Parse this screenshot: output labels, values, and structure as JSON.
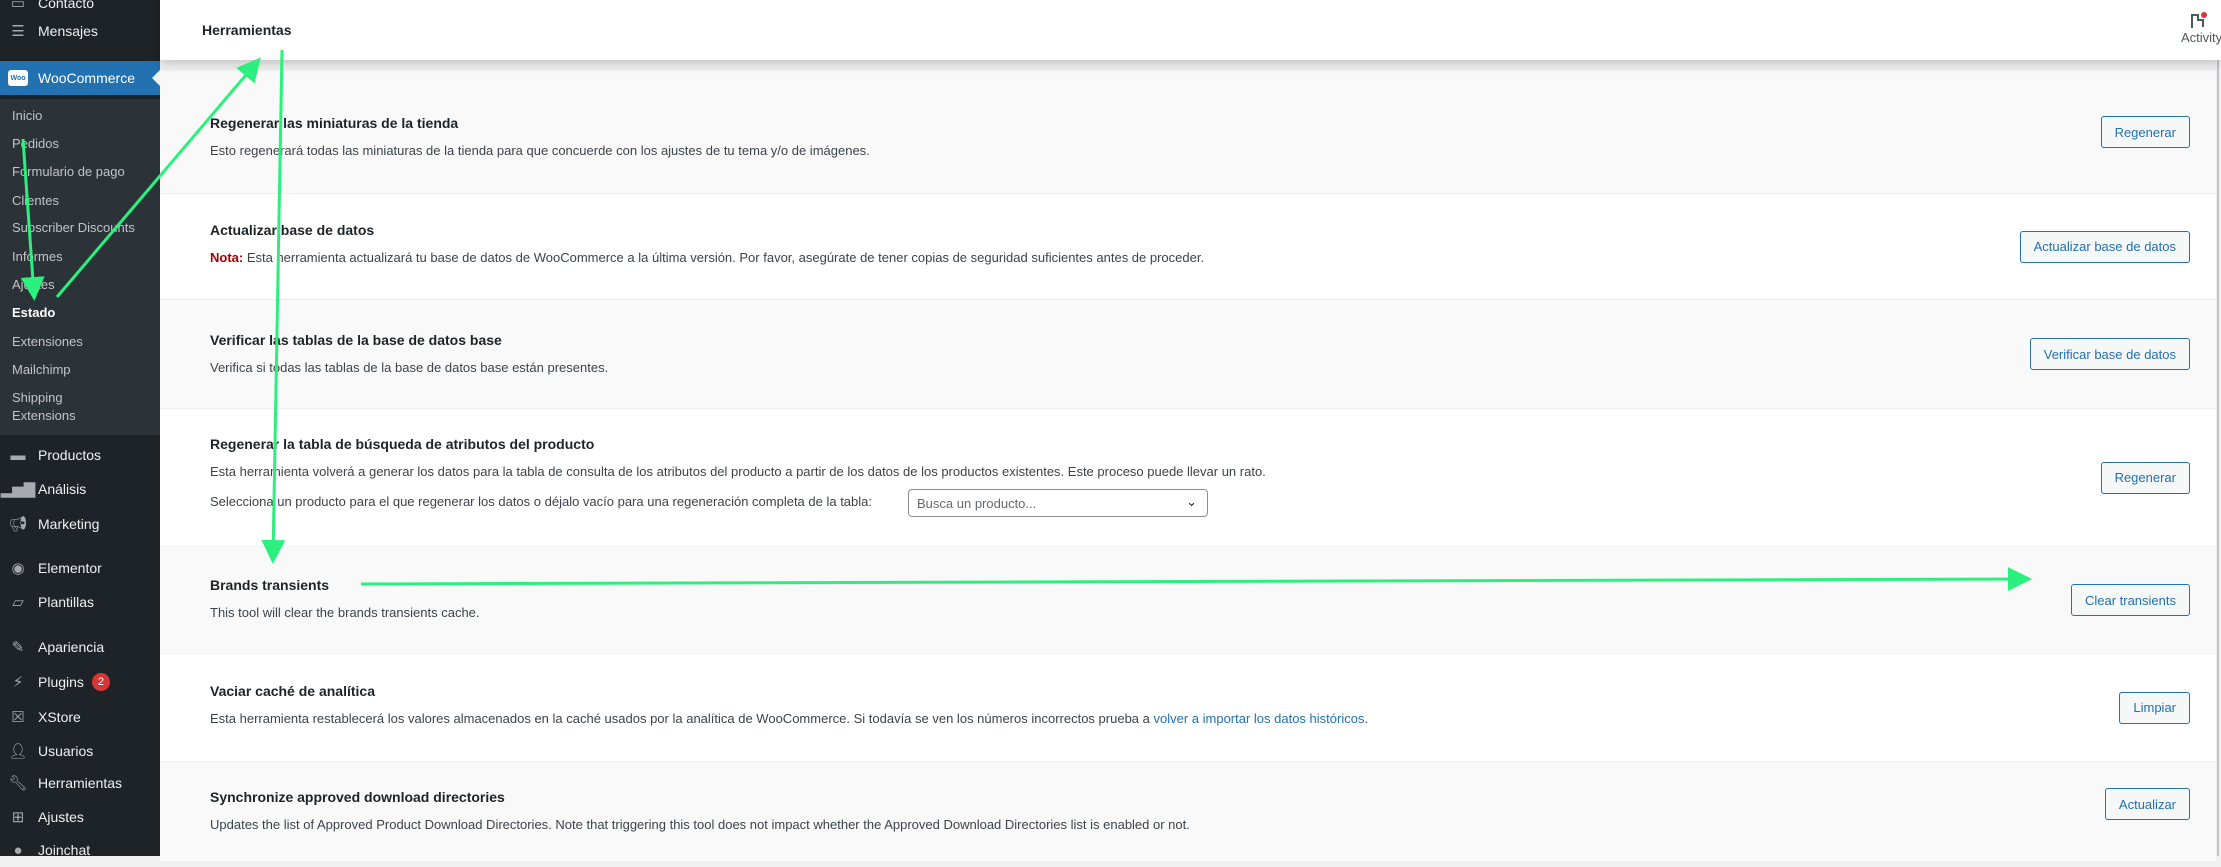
{
  "sidebar": {
    "top_items": [
      {
        "label": "Contacto",
        "icon": "contact-icon"
      },
      {
        "label": "Mensajes",
        "icon": "messages-icon"
      }
    ],
    "woocommerce": {
      "label": "WooCommerce",
      "icon_text": "Woo"
    },
    "submenu": [
      "Inicio",
      "Pedidos",
      "Formulario de pago",
      "Clientes",
      "Subscriber Discounts",
      "Informes",
      "Ajustes",
      "Estado",
      "Extensiones",
      "Mailchimp",
      "Shipping Extensions"
    ],
    "current": "Estado",
    "items": [
      {
        "label": "Productos",
        "icon": "archive-icon"
      },
      {
        "label": "Análisis",
        "icon": "chart-bar-icon"
      },
      {
        "label": "Marketing",
        "icon": "megaphone-icon"
      },
      {
        "label": "Elementor",
        "icon": "elementor-icon"
      },
      {
        "label": "Plantillas",
        "icon": "folder-icon"
      },
      {
        "label": "Apariencia",
        "icon": "paintbrush-icon"
      },
      {
        "label": "Plugins",
        "icon": "plug-icon",
        "badge": "2"
      },
      {
        "label": "XStore",
        "icon": "xstore-icon"
      },
      {
        "label": "Usuarios",
        "icon": "user-icon"
      },
      {
        "label": "Herramientas",
        "icon": "wrench-icon"
      },
      {
        "label": "Ajustes",
        "icon": "settings-icon"
      },
      {
        "label": "Joinchat",
        "icon": "whatsapp-icon"
      }
    ]
  },
  "header": {
    "title": "Herramientas",
    "activity_label": "Activity"
  },
  "tools": [
    {
      "title": "Regenerar las miniaturas de la tienda",
      "desc": "Esto regenerará todas las miniaturas de la tienda para que concuerde con los ajustes de tu tema y/o de imágenes.",
      "button": "Regenerar"
    },
    {
      "title": "Actualizar base de datos",
      "note_label": "Nota:",
      "desc": " Esta herramienta actualizará tu base de datos de WooCommerce a la última versión. Por favor, asegúrate de tener copias de seguridad suficientes antes de proceder.",
      "button": "Actualizar base de datos"
    },
    {
      "title": "Verificar las tablas de la base de datos base",
      "desc": "Verifica si todas las tablas de la base de datos base están presentes.",
      "button": "Verificar base de datos"
    },
    {
      "title": "Regenerar la tabla de búsqueda de atributos del producto",
      "desc": "Esta herramienta volverá a generar los datos para la tabla de consulta de los atributos del producto a partir de los datos de los productos existentes. Este proceso puede llevar un rato.",
      "select_label": "Selecciona un producto para el que regenerar los datos o déjalo vacío para una regeneración completa de la tabla:",
      "select_placeholder": "Busca un producto...",
      "button": "Regenerar"
    },
    {
      "title": "Brands transients",
      "desc": "This tool will clear the brands transients cache.",
      "button": "Clear transients"
    },
    {
      "title": "Vaciar caché de analítica",
      "desc": "Esta herramienta restablecerá los valores almacenados en la caché usados por la analítica de WooCommerce. Si todavía se ven los números incorrectos prueba a ",
      "link": "volver a importar los datos históricos",
      "desc_end": ".",
      "button": "Limpiar"
    },
    {
      "title": "Synchronize approved download directories",
      "desc": "Updates the list of Approved Product Download Directories. Note that triggering this tool does not impact whether the Approved Download Directories list is enabled or not.",
      "button": "Actualizar"
    }
  ],
  "colors": {
    "annotation_arrow": "#2cf07e",
    "accent": "#2271b1",
    "sidebar": "#1d2327"
  }
}
